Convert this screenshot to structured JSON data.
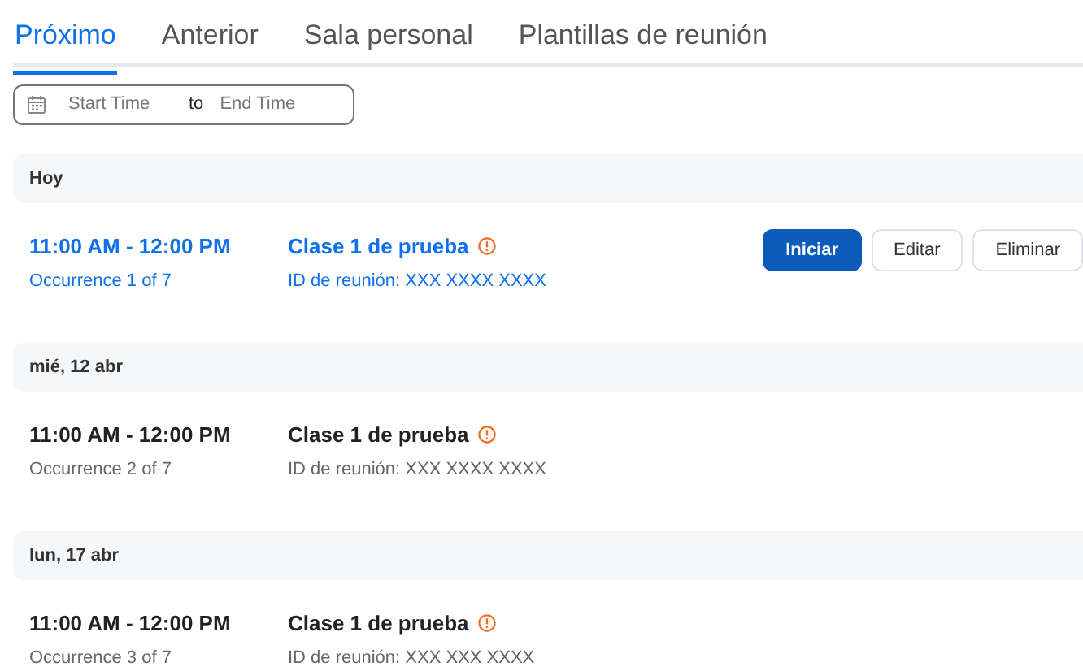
{
  "tabs": [
    {
      "label": "Próximo",
      "selected": true
    },
    {
      "label": "Anterior",
      "selected": false
    },
    {
      "label": "Sala personal",
      "selected": false
    },
    {
      "label": "Plantillas de reunión",
      "selected": false
    }
  ],
  "date_range": {
    "start_placeholder": "Start Time",
    "separator": "to",
    "end_placeholder": "End Time"
  },
  "groups": [
    {
      "date": "Hoy",
      "meetings": [
        {
          "time": "11:00 AM - 12:00 PM",
          "occurrence": "Occurrence 1 of 7",
          "title": "Clase 1 de prueba",
          "meeting_id": "ID de reunión: XXX XXXX XXXX",
          "selected": true,
          "buttons": [
            {
              "label": "Iniciar",
              "kind": "primary"
            },
            {
              "label": "Editar",
              "kind": "secondary"
            },
            {
              "label": "Eliminar",
              "kind": "secondary"
            }
          ]
        }
      ]
    },
    {
      "date": "mié, 12 abr",
      "meetings": [
        {
          "time": "11:00 AM - 12:00 PM",
          "occurrence": "Occurrence 2 of 7",
          "title": "Clase 1 de prueba",
          "meeting_id": "ID de reunión: XXX XXXX XXXX",
          "selected": false
        }
      ]
    },
    {
      "date": "lun, 17 abr",
      "meetings": [
        {
          "time": "11:00 AM - 12:00 PM",
          "occurrence": "Occurrence 3 of 7",
          "title": "Clase 1 de prueba",
          "meeting_id": "ID de reunión: XXX XXX XXXX",
          "selected": false
        }
      ]
    }
  ]
}
